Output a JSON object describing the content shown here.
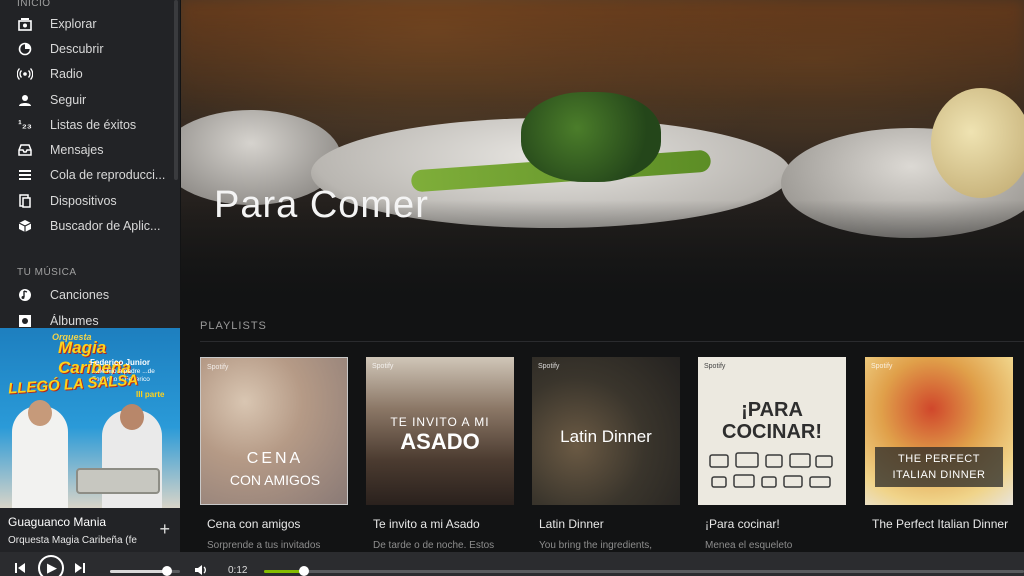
{
  "sidebar": {
    "section_main": "INICIO",
    "main_items": [
      {
        "label": "Explorar",
        "icon": "browse-icon"
      },
      {
        "label": "Descubrir",
        "icon": "discover-icon"
      },
      {
        "label": "Radio",
        "icon": "radio-icon"
      },
      {
        "label": "Seguir",
        "icon": "follow-icon"
      },
      {
        "label": "Listas de éxitos",
        "icon": "charts-icon"
      },
      {
        "label": "Mensajes",
        "icon": "inbox-icon"
      },
      {
        "label": "Cola de reproducci...",
        "icon": "queue-icon"
      },
      {
        "label": "Dispositivos",
        "icon": "devices-icon"
      },
      {
        "label": "Buscador de Aplic...",
        "icon": "app-finder-icon"
      }
    ],
    "section_music": "TU MÚSICA",
    "music_items": [
      {
        "label": "Canciones",
        "icon": "songs-icon"
      },
      {
        "label": "Álbumes",
        "icon": "albums-icon"
      }
    ]
  },
  "album_art": {
    "line1": "Orquesta",
    "line2": "Magia Caribeña",
    "line3": "Federico Junior",
    "line4": "...de hijo a padre ...de Federico a Federico",
    "line5": "LLEGÓ LA SALSA",
    "line6": "III parte"
  },
  "now_playing": {
    "title": "Guaguanco Mania",
    "artist": "Orquesta Magia Caribeña (fe",
    "add_label": "+"
  },
  "hero": {
    "title": "Para Comer"
  },
  "playlists": {
    "section_title": "PLAYLISTS",
    "brand": "Spotify",
    "items": [
      {
        "name": "Cena con amigos",
        "desc": "Sorprende a tus invitados",
        "cover_top": "CENA",
        "cover_bottom": "CON AMIGOS"
      },
      {
        "name": "Te invito a mi Asado",
        "desc": "De tarde o de noche. Estos",
        "cover_top": "TE INVITO A MI",
        "cover_bottom": "ASADO"
      },
      {
        "name": "Latin Dinner",
        "desc": "You bring the ingredients,",
        "cover_top": "Latin Dinner",
        "cover_bottom": ""
      },
      {
        "name": "¡Para cocinar!",
        "desc": "Menea el esqueleto",
        "cover_top": "¡PARA",
        "cover_bottom": "COCINAR!"
      },
      {
        "name": "The Perfect Italian Dinner",
        "desc": "",
        "cover_top": "THE PERFECT",
        "cover_bottom": "ITALIAN DINNER"
      }
    ]
  },
  "player": {
    "elapsed": "0:12",
    "volume_level": 0.82,
    "progress": 0.09,
    "prev_icon": "skip-back-icon",
    "play_icon": "play-icon",
    "next_icon": "skip-forward-icon",
    "volume_icon": "volume-icon",
    "accent": "#84bd00"
  }
}
